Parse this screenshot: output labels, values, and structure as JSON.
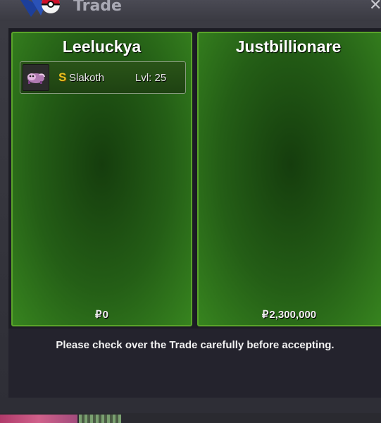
{
  "window": {
    "title": "Trade",
    "close_glyph": "✕",
    "logo_icon": "pokeball-logo-icon"
  },
  "trade": {
    "left": {
      "player": "Leeluckya",
      "items": [
        {
          "badge": "S",
          "name": "Slakoth",
          "level": "Lvl: 25",
          "icon": "slakoth-sprite-icon"
        }
      ],
      "currency_symbol": "₽",
      "money": "0"
    },
    "right": {
      "player": "Justbillionare",
      "items": [],
      "currency_symbol": "₽",
      "money": "2,300,000"
    }
  },
  "footer": {
    "notice": "Please check over the Trade carefully before accepting."
  },
  "colors": {
    "panel_border": "#5aa42a",
    "panel_green": "#245e16",
    "badge_gold": "#e8c020",
    "window_bg": "#2e2e36"
  }
}
